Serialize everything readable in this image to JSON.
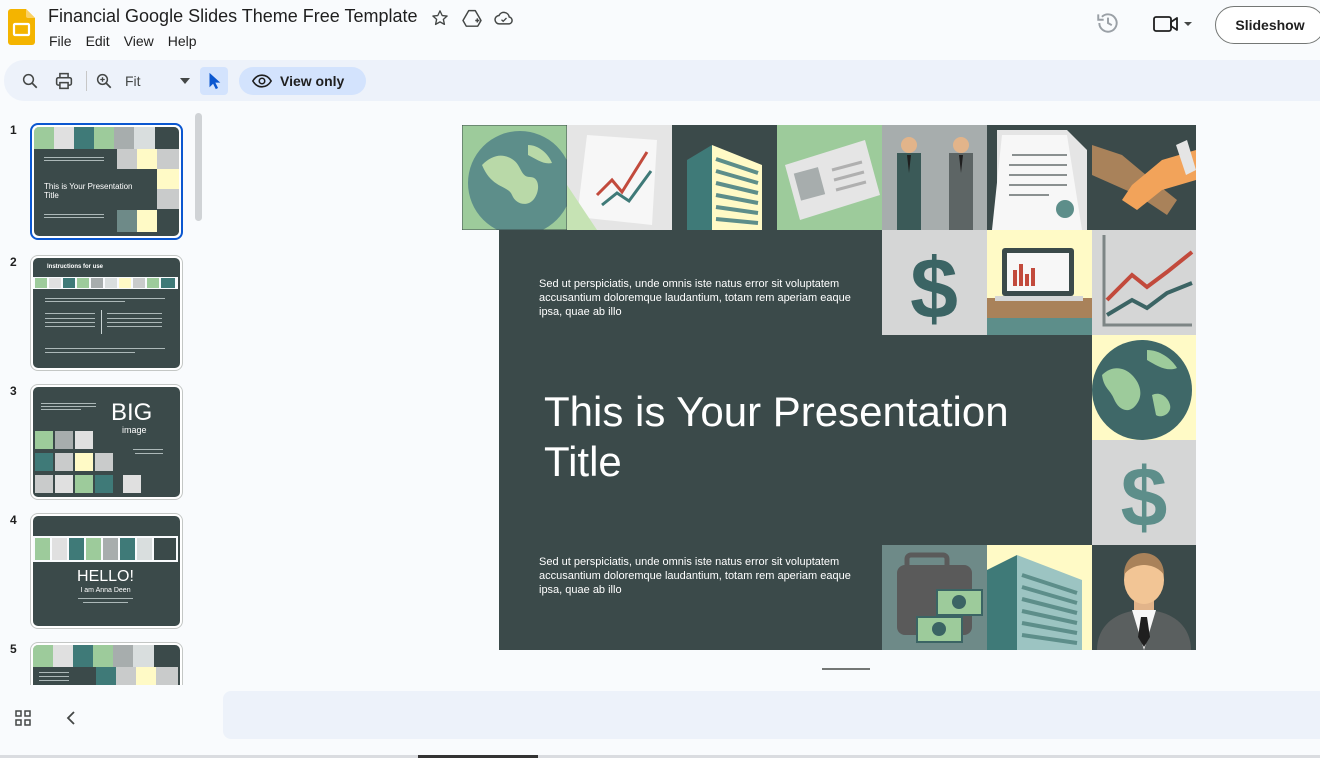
{
  "app": {
    "doc_title": "Financial Google Slides Theme Free Template",
    "menu": [
      "File",
      "Edit",
      "View",
      "Help"
    ],
    "slideshow_label": "Slideshow"
  },
  "toolbar": {
    "zoom_value": "Fit",
    "view_only_label": "View only"
  },
  "filmstrip": {
    "slides": [
      {
        "number": "1",
        "title": "This is Your Presentation Title"
      },
      {
        "number": "2",
        "title": "Instructions for use"
      },
      {
        "number": "3",
        "title": "BIG",
        "subtitle": "image"
      },
      {
        "number": "4",
        "title": "HELLO!",
        "subtitle": "I am Anna Deen"
      },
      {
        "number": "5"
      }
    ]
  },
  "slide": {
    "title": "This is Your Presentation Title",
    "body_top": "Sed ut perspiciatis, unde omnis iste natus error sit voluptatem accusantium doloremque laudantium, totam rem aperiam eaque ipsa, quae ab illo",
    "body_bottom": "Sed ut perspiciatis, unde omnis iste natus error sit voluptatem accusantium doloremque laudantium, totam rem aperiam eaque ipsa, quae ab illo"
  },
  "colors": {
    "panel": "#3b4a4a",
    "accent_blue": "#0b57d0",
    "toolbar_bg": "#edf2fa",
    "teal": "#3f7a78",
    "green_tile": "#9dcb9b",
    "gray_tile": "#c9cbcb",
    "yellow_tile": "#fffac6"
  }
}
